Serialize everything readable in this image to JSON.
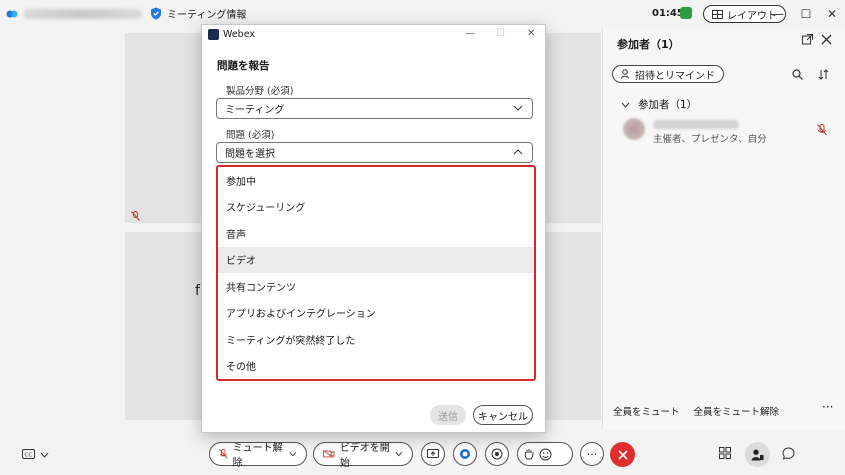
{
  "topbar": {
    "meeting_info": "ミーティング情報",
    "clock": "01:45",
    "layout_label": "レイアウト",
    "minimize": "—",
    "maximize": "☐",
    "close": "✕"
  },
  "tile_letter": "f",
  "dialog": {
    "app_name": "Webex",
    "heading": "問題を報告",
    "product_label": "製品分野 (必須)",
    "product_value": "ミーティング",
    "issue_label": "問題 (必須)",
    "issue_placeholder": "問題を選択",
    "options": [
      "参加中",
      "スケジューリング",
      "音声",
      "ビデオ",
      "共有コンテンツ",
      "アプリおよびインテグレーション",
      "ミーティングが突然終了した",
      "その他"
    ],
    "highlighted_option": "ビデオ",
    "send_label": "送信",
    "cancel_label": "キャンセル"
  },
  "panel": {
    "title": "参加者（1）",
    "invite_label": "招待とリマインド",
    "group_label": "参加者（1）",
    "participant_role": "主催者、プレゼンタ、自分",
    "mute_all": "全員をミュート",
    "unmute_all": "全員をミュート解除",
    "more": "···"
  },
  "toolbar": {
    "unmute_label": "ミュート解除",
    "video_label": "ビデオを開始",
    "more": "···"
  },
  "colors": {
    "accent_red": "#e02c2c",
    "highlight_border": "#d42a2a",
    "signal_green": "#2e9a42"
  }
}
